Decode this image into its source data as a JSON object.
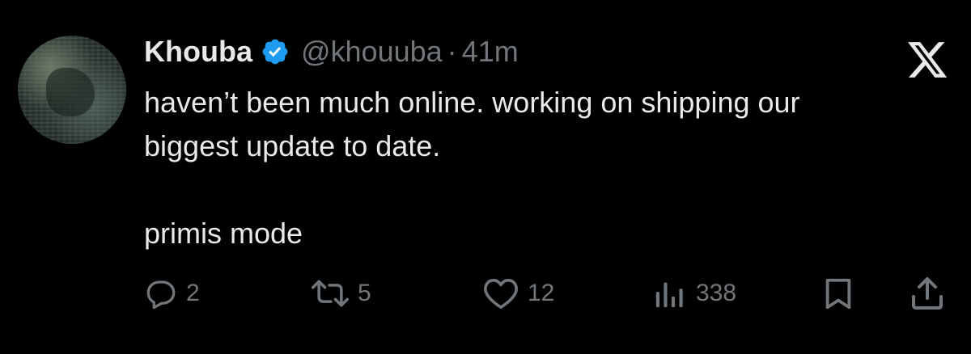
{
  "tweet": {
    "display_name": "Khouba",
    "handle": "@khouuba",
    "separator": "·",
    "time": "41m",
    "text_line1": "haven’t been much online. working on shipping our",
    "text_line2": "biggest update to date.",
    "text_line3": "primis mode"
  },
  "actions": {
    "replies": "2",
    "reposts": "5",
    "likes": "12",
    "views": "338"
  },
  "icons": {
    "verified": "verified-badge-icon",
    "platform": "x-logo-icon",
    "reply": "reply-icon",
    "repost": "repost-icon",
    "like": "heart-icon",
    "views": "views-icon",
    "bookmark": "bookmark-icon",
    "share": "share-icon"
  },
  "colors": {
    "background": "#000000",
    "text": "#e7e9ea",
    "secondary": "#71767b",
    "verified": "#1d9bf0"
  }
}
